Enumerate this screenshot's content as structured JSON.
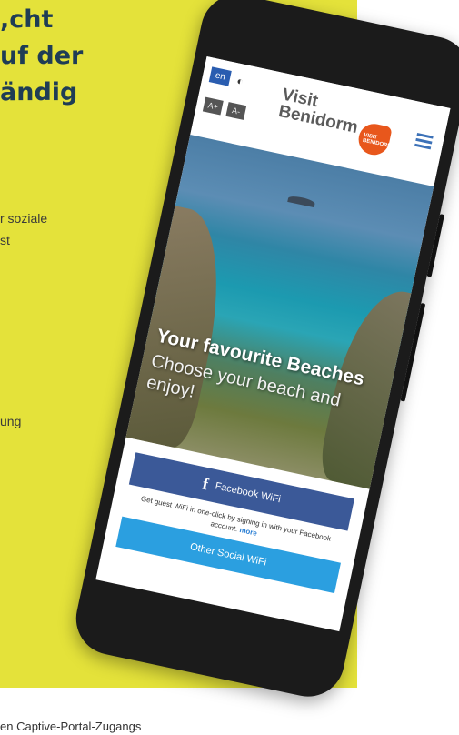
{
  "marketing": {
    "headline": [
      "cht,",
      "uf der",
      "ändig"
    ],
    "text_lines": [
      "r soziale",
      "st",
      "ung"
    ],
    "footer": "en Captive-Portal-Zugangs"
  },
  "app": {
    "lang": "en",
    "contrast_glyph": "◐",
    "font_buttons": [
      "A+",
      "A-"
    ],
    "logo": {
      "line1": "Visit",
      "line2": "Benidorm",
      "mark": "VISIT BENIDORM"
    },
    "menu_icon": "hamburger-icon",
    "hero": {
      "title": "Your favourite Beaches",
      "subtitle": "Choose your beach and enjoy!"
    },
    "facebook_button": {
      "icon": "f",
      "label": "Facebook WiFi"
    },
    "wifi_note": {
      "text": "Get guest WiFi in one-click by signing in with your Facebook account.",
      "more": "more"
    },
    "other_button": "Other Social WiFi"
  },
  "colors": {
    "panel": "#e4e23a",
    "headline": "#1f3d55",
    "facebook": "#3b5998",
    "accent": "#2b9fe0",
    "logo": "#e8571c"
  }
}
